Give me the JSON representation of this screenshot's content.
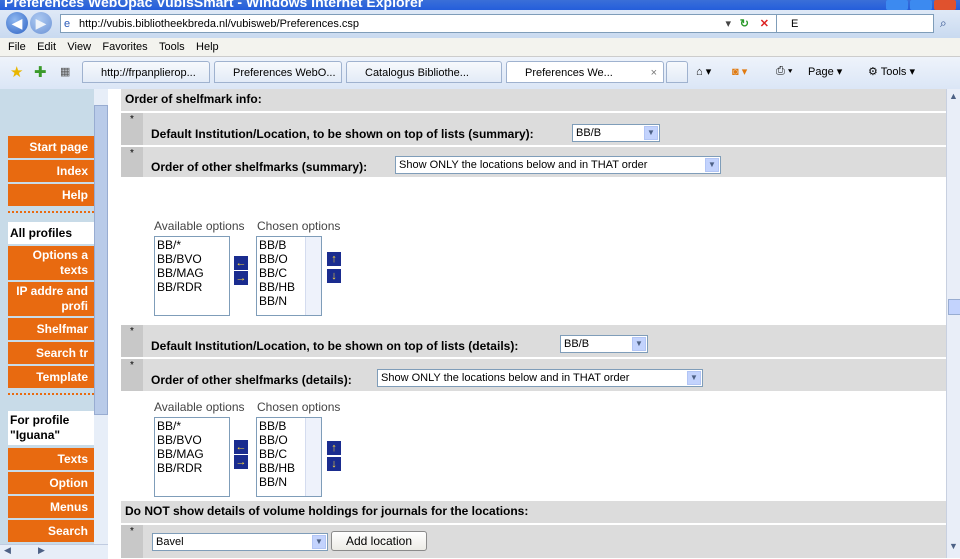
{
  "window": {
    "title": "Preferences WebOpac VubisSmart - Windows Internet Explorer"
  },
  "address": {
    "url": "http://vubis.bibliotheekbreda.nl/vubisweb/Preferences.csp",
    "search_value": "E"
  },
  "menu": [
    "File",
    "Edit",
    "View",
    "Favorites",
    "Tools",
    "Help"
  ],
  "tabs": [
    {
      "label": "http://frpanplierop..."
    },
    {
      "label": "Preferences WebO..."
    },
    {
      "label": "Catalogus Bibliothe..."
    },
    {
      "label": "Preferences We...",
      "close": "×"
    }
  ],
  "toolbar": {
    "page_label": "Page ▾",
    "tools_label": "Tools ▾"
  },
  "sidebar": {
    "start": "Start page",
    "index": "Index",
    "help": "Help",
    "all_profiles": "All profiles",
    "options_texts": "Options a texts",
    "ip_address": "IP addre and profi",
    "shelfmark": "Shelfmar",
    "search_tr": "Search tr",
    "template": "Template",
    "for_profile": "For profile \"Iguana\"",
    "texts": "Texts",
    "options": "Option",
    "menus": "Menus",
    "search": "Search"
  },
  "main": {
    "section1_title": "Order of shelfmark info:",
    "default_summary_label": "Default Institution/Location, to be shown on top of lists (summary):",
    "default_summary_value": "BB/B",
    "order_summary_label": "Order of other shelfmarks (summary):",
    "order_summary_value": "Show ONLY the locations below and in THAT order",
    "available_header": "Available options",
    "chosen_header": "Chosen options",
    "available_options": [
      "BB/*",
      "BB/BVO",
      "BB/MAG",
      "BB/RDR"
    ],
    "chosen_options": [
      "BB/B",
      "BB/O",
      "BB/C",
      "BB/HB",
      "BB/N"
    ],
    "default_details_label": "Default Institution/Location, to be shown on top of lists (details):",
    "default_details_value": "BB/B",
    "order_details_label": "Order of other shelfmarks (details):",
    "order_details_value": "Show ONLY the locations below and in THAT order",
    "section2_title": "Do NOT show details of volume holdings for journals for the locations:",
    "location_value": "Bavel",
    "add_location_label": "Add location"
  },
  "arrows": {
    "left": "←",
    "right": "→",
    "up": "↑",
    "down": "↓"
  },
  "colors": {
    "sidebar_button": "#e86a10",
    "arrow_button": "#1a2c8f",
    "section_bg": "#dcdcdc"
  }
}
